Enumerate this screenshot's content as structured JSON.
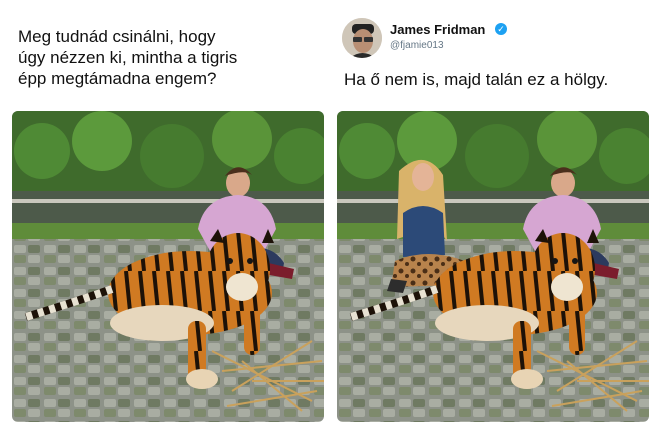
{
  "left_panel": {
    "request_text": "Meg tudnád csinálni, hogy\núgy nézzen ki, mintha a tigris\népp megtámadna engem?"
  },
  "right_panel": {
    "author_name": "James Fridman",
    "author_handle": "@fjamie013",
    "verified_symbol": "✓",
    "reply_text": "Ha ő nem is, majd talán ez a hölgy."
  },
  "colors": {
    "verified_blue": "#1da1f2",
    "handle_gray": "#657786"
  }
}
